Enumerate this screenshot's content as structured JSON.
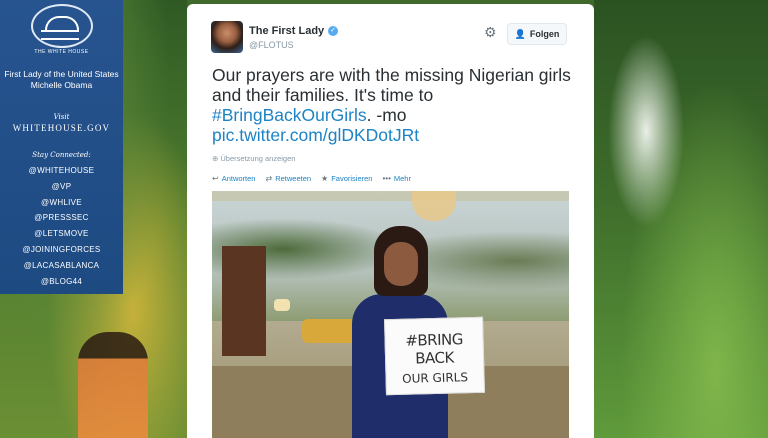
{
  "sidebar": {
    "seal_text": "THE WHITE HOUSE",
    "title_line1": "First Lady of the United States",
    "title_line2": "Michelle Obama",
    "visit_label": "Visit",
    "visit_site": "WHITEHOUSE.GOV",
    "stay_label": "Stay Connected:",
    "links": [
      "@WHITEHOUSE",
      "@VP",
      "@WHLIVE",
      "@PRESSSEC",
      "@LETSMOVE",
      "@JOININGFORCES",
      "@LACASABLANCA",
      "@BLOG44"
    ]
  },
  "tweet": {
    "name": "The First Lady",
    "handle": "@FLOTUS",
    "follow_label": "Folgen",
    "text_before": "Our prayers are with the missing Nigerian girls and their families. It's time to ",
    "hashtag": "#BringBackOurGirls",
    "text_after": ". -mo",
    "pic_link": "pic.twitter.com/glDKDotJRt",
    "translate_label": "Übersetzung anzeigen",
    "actions": {
      "reply": "Antworten",
      "retweet": "Retweeten",
      "favorite": "Favorisieren",
      "more": "Mehr"
    },
    "sign": {
      "line1": "#BRING BACK",
      "line2": "OUR GIRLS"
    }
  },
  "colors": {
    "link": "#1d83c5",
    "sidebar": "#27548f",
    "verified": "#55acee"
  },
  "icons": {
    "settings": "gear-icon",
    "follow": "add-person-icon",
    "verified": "verified-badge-icon",
    "reply": "reply-icon",
    "retweet": "retweet-icon",
    "favorite": "star-icon",
    "more": "more-dots-icon"
  }
}
